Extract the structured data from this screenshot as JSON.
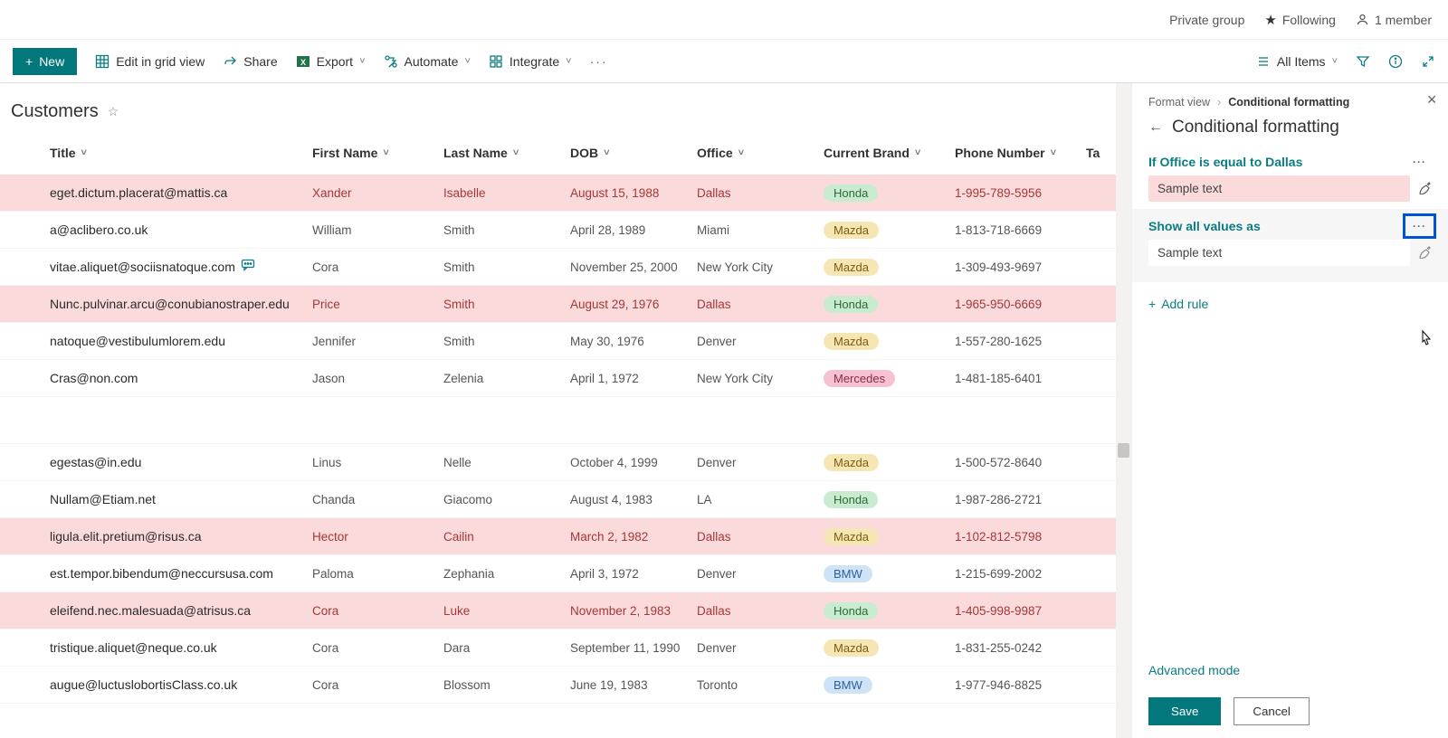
{
  "top": {
    "group": "Private group",
    "following": "Following",
    "members": "1 member"
  },
  "cmd": {
    "new": "New",
    "edit_grid": "Edit in grid view",
    "share": "Share",
    "export": "Export",
    "automate": "Automate",
    "integrate": "Integrate",
    "all_items": "All Items"
  },
  "list": {
    "title": "Customers",
    "columns": {
      "title": "Title",
      "first": "First Name",
      "last": "Last Name",
      "dob": "DOB",
      "office": "Office",
      "brand": "Current Brand",
      "phone": "Phone Number",
      "ta": "Ta"
    }
  },
  "rows": [
    {
      "hl": true,
      "title": "eget.dictum.placerat@mattis.ca",
      "first": "Xander",
      "last": "Isabelle",
      "dob": "August 15, 1988",
      "office": "Dallas",
      "brand": "Honda",
      "phone": "1-995-789-5956"
    },
    {
      "hl": false,
      "title": "a@aclibero.co.uk",
      "first": "William",
      "last": "Smith",
      "dob": "April 28, 1989",
      "office": "Miami",
      "brand": "Mazda",
      "phone": "1-813-718-6669"
    },
    {
      "hl": false,
      "title": "vitae.aliquet@sociisnatoque.com",
      "first": "Cora",
      "last": "Smith",
      "dob": "November 25, 2000",
      "office": "New York City",
      "brand": "Mazda",
      "phone": "1-309-493-9697",
      "comment": true
    },
    {
      "hl": true,
      "title": "Nunc.pulvinar.arcu@conubianostraper.edu",
      "first": "Price",
      "last": "Smith",
      "dob": "August 29, 1976",
      "office": "Dallas",
      "brand": "Honda",
      "phone": "1-965-950-6669"
    },
    {
      "hl": false,
      "title": "natoque@vestibulumlorem.edu",
      "first": "Jennifer",
      "last": "Smith",
      "dob": "May 30, 1976",
      "office": "Denver",
      "brand": "Mazda",
      "phone": "1-557-280-1625"
    },
    {
      "hl": false,
      "title": "Cras@non.com",
      "first": "Jason",
      "last": "Zelenia",
      "dob": "April 1, 1972",
      "office": "New York City",
      "brand": "Mercedes",
      "phone": "1-481-185-6401"
    },
    {
      "gap": true
    },
    {
      "hl": false,
      "title": "egestas@in.edu",
      "first": "Linus",
      "last": "Nelle",
      "dob": "October 4, 1999",
      "office": "Denver",
      "brand": "Mazda",
      "phone": "1-500-572-8640"
    },
    {
      "hl": false,
      "title": "Nullam@Etiam.net",
      "first": "Chanda",
      "last": "Giacomo",
      "dob": "August 4, 1983",
      "office": "LA",
      "brand": "Honda",
      "phone": "1-987-286-2721"
    },
    {
      "hl": true,
      "title": "ligula.elit.pretium@risus.ca",
      "first": "Hector",
      "last": "Cailin",
      "dob": "March 2, 1982",
      "office": "Dallas",
      "brand": "Mazda",
      "phone": "1-102-812-5798"
    },
    {
      "hl": false,
      "title": "est.tempor.bibendum@neccursusa.com",
      "first": "Paloma",
      "last": "Zephania",
      "dob": "April 3, 1972",
      "office": "Denver",
      "brand": "BMW",
      "phone": "1-215-699-2002"
    },
    {
      "hl": true,
      "title": "eleifend.nec.malesuada@atrisus.ca",
      "first": "Cora",
      "last": "Luke",
      "dob": "November 2, 1983",
      "office": "Dallas",
      "brand": "Honda",
      "phone": "1-405-998-9987"
    },
    {
      "hl": false,
      "title": "tristique.aliquet@neque.co.uk",
      "first": "Cora",
      "last": "Dara",
      "dob": "September 11, 1990",
      "office": "Denver",
      "brand": "Mazda",
      "phone": "1-831-255-0242"
    },
    {
      "hl": false,
      "title": "augue@luctuslobortisClass.co.uk",
      "first": "Cora",
      "last": "Blossom",
      "dob": "June 19, 1983",
      "office": "Toronto",
      "brand": "BMW",
      "phone": "1-977-946-8825"
    }
  ],
  "panel": {
    "crumb1": "Format view",
    "crumb2": "Conditional formatting",
    "title": "Conditional formatting",
    "rule1": "If Office is equal to Dallas",
    "sample": "Sample text",
    "rule2": "Show all values as",
    "add_rule": "Add rule",
    "advanced": "Advanced mode",
    "save": "Save",
    "cancel": "Cancel"
  }
}
